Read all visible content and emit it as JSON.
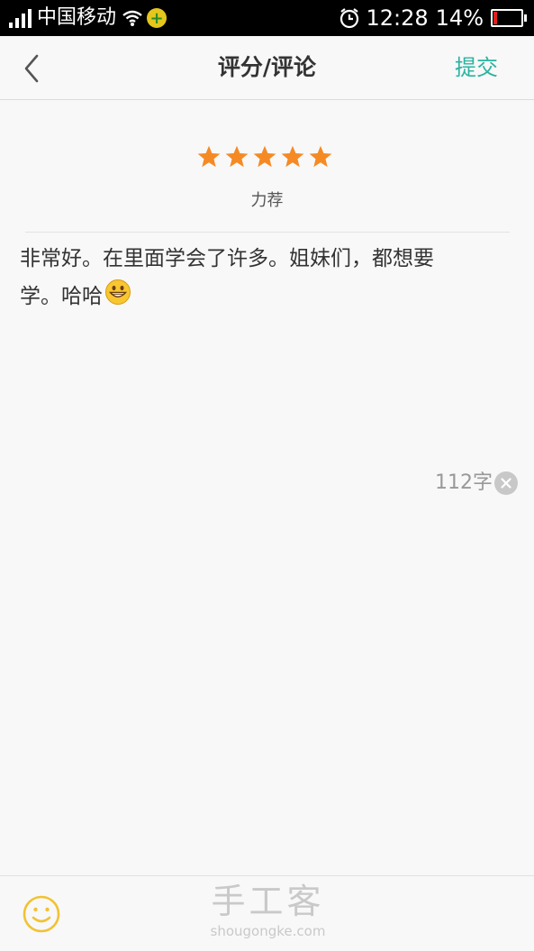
{
  "status_bar": {
    "carrier": "中国移动",
    "time": "12:28",
    "battery_percent": "14%",
    "battery_level": 0.14,
    "icons": [
      "signal-icon",
      "wifi-icon",
      "app-badge-icon",
      "alarm-icon",
      "battery-icon"
    ]
  },
  "header": {
    "title": "评分/评论",
    "submit_label": "提交",
    "back_icon": "chevron-left-icon",
    "accent_color": "#2bb3a0"
  },
  "rating": {
    "stars": 5,
    "max_stars": 5,
    "label": "力荐",
    "star_color": "#f58a25"
  },
  "review": {
    "lines": [
      "非常好。在里面学会了许多。姐妹们，都想要",
      "学。哈哈"
    ],
    "emoji": "grinning-face-emoji"
  },
  "counter": {
    "text": "112字",
    "clear_icon": "clear-x-icon"
  },
  "bottom_bar": {
    "emoji_button_icon": "smiley-icon"
  },
  "watermark": {
    "cn": "手工客",
    "en": "shougongke.com"
  }
}
